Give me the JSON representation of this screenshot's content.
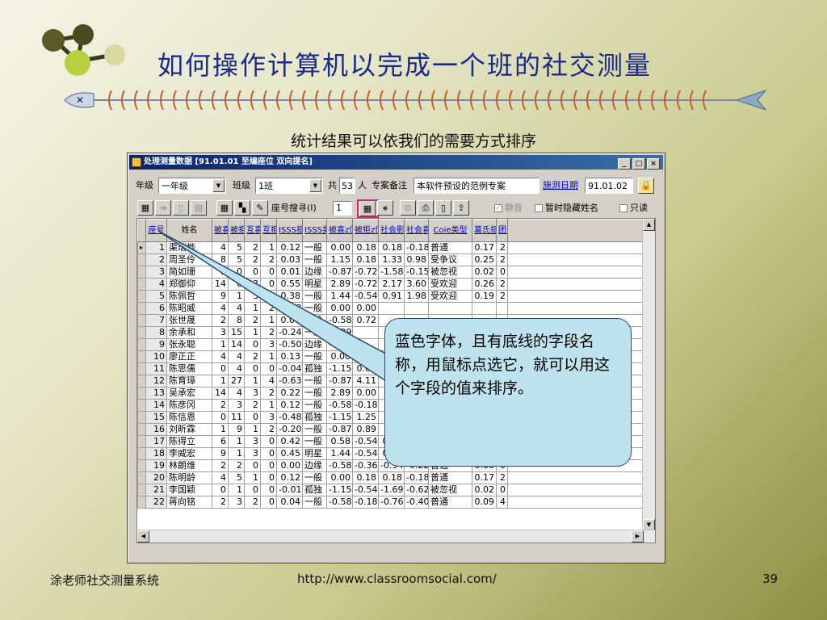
{
  "slide": {
    "title": "如何操作计算机以完成一个班的社交测量",
    "subtitle": "统计结果可以依我们的需要方式排序",
    "callout": "蓝色字体，且有底线的字段名称，用鼠标点选它，就可以用这个字段的值来排序。",
    "footer_left": "涂老师社交测量系统",
    "footer_url": "http://www.classroomsocial.com/",
    "page_number": "39"
  },
  "window": {
    "title": "处理测量数据 [91.01.01  至编座位  双向提名]",
    "buttons": {
      "minimize": "_",
      "maximize": "□",
      "close": "×"
    }
  },
  "form": {
    "grade_label": "年级",
    "grade_value": "一年级",
    "class_label": "班级",
    "class_value": "1班",
    "total_label": "共",
    "total_value": "53",
    "people_label": "人",
    "note_label": "专案备注",
    "note_value": "本软件预设的范例专案",
    "date_label": "施测日期",
    "date_value": "91.01.02"
  },
  "toolbar": {
    "seat_search_label": "座号搜寻(I)",
    "seat_search_value": "1",
    "mute_label": "静音",
    "hide_names_label": "暂时隐藏姓名",
    "only_label": "只读"
  },
  "table": {
    "headers": [
      "座号",
      "姓名",
      "被喜",
      "被拒",
      "互喜",
      "互拒",
      "ISSS指数",
      "ISSS类型",
      "被喜z值",
      "被拒z值",
      "社会影响",
      "社会喜好",
      "Coie类型",
      "葛氏指数",
      "团号"
    ],
    "rows": [
      [
        "1",
        "渠瑞桦",
        "4",
        "5",
        "2",
        "1",
        "0.12",
        "一般",
        "0.00",
        "0.18",
        "0.18",
        "-0.18",
        "普通",
        "0.17",
        "2"
      ],
      [
        "2",
        "周圣伶",
        "8",
        "5",
        "2",
        "2",
        "0.03",
        "一般",
        "1.15",
        "0.18",
        "1.33",
        "0.98",
        "受争议",
        "0.25",
        "2"
      ],
      [
        "3",
        "简如珊",
        "1",
        "0",
        "0",
        "0",
        "0.01",
        "边缘",
        "-0.87",
        "-0.72",
        "-1.58",
        "-0.15",
        "被忽视",
        "0.02",
        "0"
      ],
      [
        "4",
        "郑御仰",
        "14",
        "0",
        "3",
        "0",
        "0.55",
        "明星",
        "2.89",
        "-0.72",
        "2.17",
        "3.60",
        "受欢迎",
        "0.26",
        "2"
      ],
      [
        "5",
        "陈佩哲",
        "9",
        "1",
        "3",
        "1",
        "0.38",
        "一般",
        "1.44",
        "-0.54",
        "0.91",
        "1.98",
        "受欢迎",
        "0.19",
        "2"
      ],
      [
        "6",
        "陈昭威",
        "4",
        "4",
        "1",
        "2",
        "-0.13",
        "一般",
        "0.00",
        "0.00",
        "",
        "",
        "",
        "",
        ""
      ],
      [
        "7",
        "张世晟",
        "2",
        "8",
        "2",
        "1",
        "0.07",
        "一般",
        "-0.58",
        "0.72",
        "",
        "",
        "",
        "",
        ""
      ],
      [
        "8",
        "余承和",
        "3",
        "15",
        "1",
        "2",
        "-0.24",
        "一般",
        "-0.29",
        "",
        "",
        "",
        "",
        "",
        ""
      ],
      [
        "9",
        "张永聪",
        "1",
        "14",
        "0",
        "3",
        "-0.50",
        "边缘",
        "-0.87",
        "",
        "",
        "",
        "",
        "",
        ""
      ],
      [
        "10",
        "廖正正",
        "4",
        "4",
        "2",
        "1",
        "0.13",
        "一般",
        "0.00",
        "0.00",
        "",
        "",
        "",
        "",
        ""
      ],
      [
        "11",
        "陈思儒",
        "0",
        "4",
        "0",
        "0",
        "-0.04",
        "孤独",
        "-1.15",
        "0.00",
        "",
        "",
        "",
        "",
        ""
      ],
      [
        "12",
        "陈育璋",
        "1",
        "27",
        "1",
        "4",
        "-0.63",
        "一般",
        "-0.87",
        "4.11",
        "",
        "",
        "",
        "",
        ""
      ],
      [
        "13",
        "吴承宏",
        "14",
        "4",
        "3",
        "2",
        "0.22",
        "一般",
        "2.89",
        "0.00",
        "",
        "",
        "",
        "",
        ""
      ],
      [
        "14",
        "陈彦冈",
        "2",
        "3",
        "2",
        "1",
        "0.12",
        "一般",
        "-0.58",
        "-0.18",
        "",
        "",
        "",
        "",
        ""
      ],
      [
        "15",
        "陈信恩",
        "0",
        "11",
        "0",
        "3",
        "-0.48",
        "孤独",
        "-1.15",
        "1.25",
        "",
        "",
        "",
        "",
        ""
      ],
      [
        "16",
        "刘昕霖",
        "1",
        "9",
        "1",
        "2",
        "-0.20",
        "一般",
        "-0.87",
        "0.89",
        "",
        "",
        "",
        "",
        ""
      ],
      [
        "17",
        "陈得立",
        "6",
        "1",
        "3",
        "0",
        "0.42",
        "一般",
        "0.58",
        "-0.54",
        "0.04",
        "1.11",
        "受欢迎",
        "0.13",
        "2"
      ],
      [
        "18",
        "李威宏",
        "9",
        "1",
        "3",
        "0",
        "0.45",
        "明星",
        "1.44",
        "-0.54",
        "0.91",
        "1.98",
        "受欢迎",
        "0.19",
        "2"
      ],
      [
        "19",
        "林朗维",
        "2",
        "2",
        "0",
        "0",
        "0.00",
        "边缘",
        "-0.58",
        "-0.36",
        "-0.94",
        "-0.22",
        "普通",
        "0.08",
        "0"
      ],
      [
        "20",
        "陈明龄",
        "4",
        "5",
        "1",
        "0",
        "0.12",
        "一般",
        "0.00",
        "0.18",
        "0.18",
        "-0.18",
        "普通",
        "0.17",
        "2"
      ],
      [
        "21",
        "李国颖",
        "0",
        "1",
        "0",
        "0",
        "-0.01",
        "孤独",
        "-1.15",
        "-0.54",
        "-1.69",
        "-0.62",
        "被忽视",
        "0.02",
        "0"
      ],
      [
        "22",
        "蒋向铭",
        "2",
        "3",
        "2",
        "0",
        "0.04",
        "一般",
        "-0.58",
        "-0.18",
        "-0.76",
        "-0.40",
        "普通",
        "0.09",
        "4"
      ]
    ]
  },
  "colors": {
    "title_text": "#1a2a8a",
    "link_blue": "#0000cc",
    "highlight_border": "#e0206a",
    "callout_fill": "#bfe3ee",
    "titlebar_start": "#0a246a"
  }
}
